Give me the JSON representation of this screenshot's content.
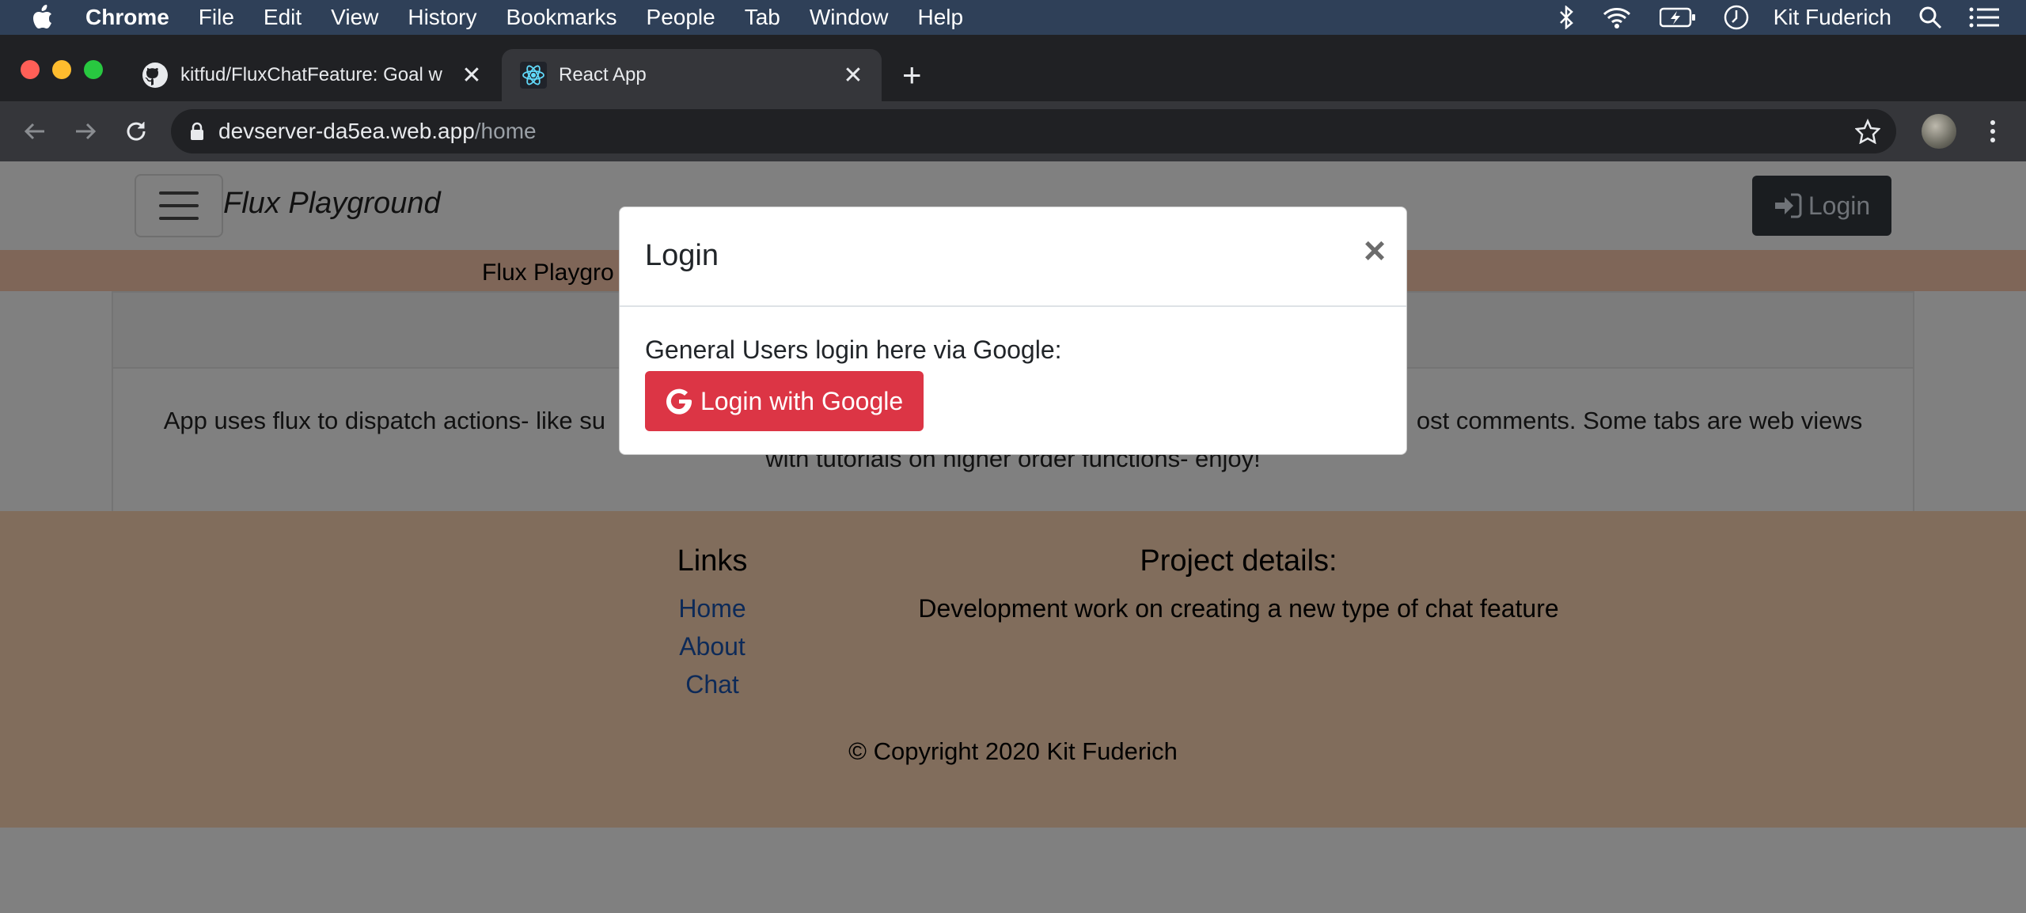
{
  "menubar": {
    "items": [
      "Chrome",
      "File",
      "Edit",
      "View",
      "History",
      "Bookmarks",
      "People",
      "Tab",
      "Window",
      "Help"
    ],
    "user": "Kit Fuderich"
  },
  "browser": {
    "tabs": [
      {
        "title": "kitfud/FluxChatFeature: Goal w",
        "icon": "github-icon"
      },
      {
        "title": "React App",
        "icon": "react-icon"
      }
    ],
    "url_host": "devserver-da5ea.web.app",
    "url_path": "/home"
  },
  "page": {
    "brand": "Flux Playground",
    "login_button": "Login",
    "banner_text": "Flux Playgro",
    "description_line1": "App uses flux to dispatch actions- like su                                                                                                                       ost comments. Some tabs are web views",
    "description_line2": "with tutorials on higher order functions- enjoy!",
    "footer": {
      "links_heading": "Links",
      "links": [
        "Home",
        "About",
        "Chat"
      ],
      "project_heading": "Project details:",
      "project_text": "Development work on creating a new type of chat feature",
      "copyright": "© Copyright 2020 Kit Fuderich"
    }
  },
  "modal": {
    "title": "Login",
    "close": "×",
    "body_text": "General Users login here via Google:",
    "google_button": "Login with Google"
  },
  "colors": {
    "menubar": "#2f4058",
    "tabstrip": "#202124",
    "toolbar": "#35363a",
    "backdrop": "#808080",
    "banner": "#7f6658",
    "footer": "#816d5c",
    "google_button": "#dc3545"
  }
}
